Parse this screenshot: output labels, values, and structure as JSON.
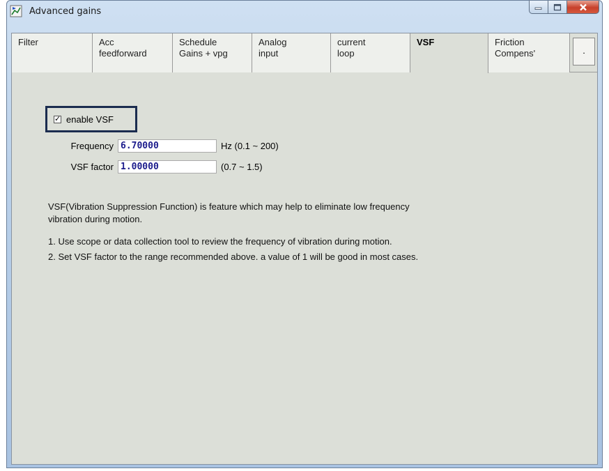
{
  "window": {
    "title": "Advanced gains",
    "icons": {
      "app": "chart-icon",
      "minimize": "minimize-icon",
      "maximize": "maximize-icon",
      "close": "close-icon"
    }
  },
  "tabs": [
    {
      "line1": "Filter",
      "line2": ""
    },
    {
      "line1": "Acc",
      "line2": "feedforward"
    },
    {
      "line1": "Schedule",
      "line2": "Gains + vpg"
    },
    {
      "line1": "Analog",
      "line2": "input"
    },
    {
      "line1": "current",
      "line2": "loop"
    },
    {
      "line1": "VSF",
      "line2": "",
      "active": true
    },
    {
      "line1": "Friction",
      "line2": "Compens'"
    }
  ],
  "tab_more_label": ".",
  "vsf": {
    "enable_label": "enable VSF",
    "enabled": true,
    "frequency": {
      "label": "Frequency",
      "value": "6.70000",
      "range": "Hz (0.1 ~ 200)"
    },
    "factor": {
      "label": "VSF factor",
      "value": "1.00000",
      "range": "(0.7 ~ 1.5)"
    }
  },
  "description": {
    "line1": "VSF(Vibration Suppression Function) is feature which may help to eliminate low frequency",
    "line2": "vibration during motion.",
    "step1": "1. Use scope or data collection tool to review the frequency of vibration during motion.",
    "step2": "2. Set VSF factor to the range recommended above. a value of 1 will be good in most cases."
  },
  "colors": {
    "highlight_border": "#1b2c4f",
    "input_text": "#1c1c8c",
    "close_button": "#c7402b"
  }
}
